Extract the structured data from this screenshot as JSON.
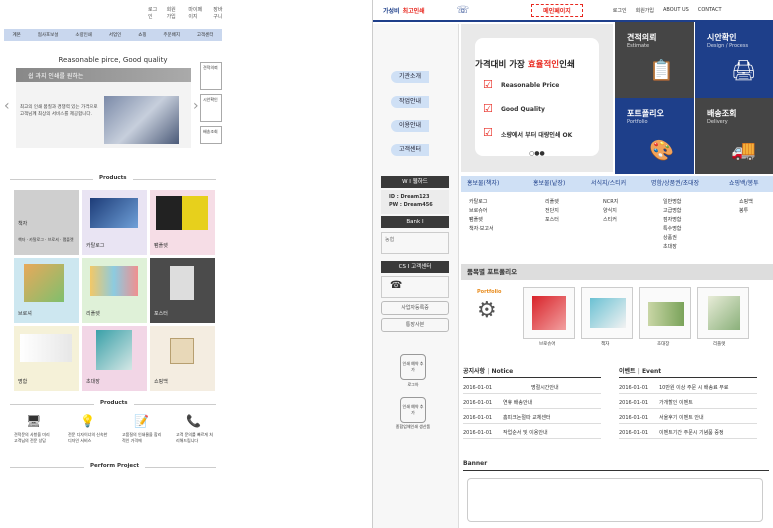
{
  "left": {
    "top_links": [
      "로그인",
      "회원가입",
      "마이페이지",
      "장바구니"
    ],
    "nav": [
      "계본",
      "협사포보설",
      "소량인쇄",
      "서업인",
      "쇼핑",
      "주문배지",
      "고객센터"
    ],
    "tagline": "Reasonable pirce, Good quality",
    "banner_head": "쉽 과지 인쇄를 원하는",
    "banner_text": "최고의 인쇄 품질과 경쟁력 있는 가격으로 고객님께 최상의 서비스를 제공합니다.",
    "side_boxes": [
      "견적의뢰",
      "시안확인",
      "배송조회"
    ],
    "products_title": "Products",
    "tiles": [
      "책자",
      "카탈로그",
      "팸플렛",
      "브로셔",
      "리플렛",
      "포스터",
      "명함",
      "초대장",
      "쇼핑백"
    ],
    "tile_overlay": "책자 · 카탈로그 · 브로셔 · 팸플렛",
    "products2_title": "Products",
    "features": [
      "견적문의 사항을 미리 고객님의 전문 상담",
      "전문 디자이너의 신속한 디자인 서비스",
      "고품질의 인쇄물을 합리적인 가격에",
      "고객 문의를 빠르게 처리해드립니다"
    ],
    "perform_title": "Perform Project"
  },
  "right": {
    "brand_prefix": "가성비",
    "brand_name": "최고인쇄",
    "main_page": "메인페이지",
    "top_links": [
      "로그인",
      "회원가입",
      "ABOUT US",
      "CONTACT"
    ],
    "side_menu": [
      "기관소개",
      "작업안내",
      "이용안내",
      "고객센터"
    ],
    "webhard_title": "W  I  웹하드",
    "webhard_id": "ID : Dream123",
    "webhard_pw": "PW : Dream456",
    "bank_title": "Bank  I",
    "bank_name": "농협",
    "cs_title": "CS  I  고객센터",
    "cs_buttons": [
      "사업자등록증",
      "통장사본"
    ],
    "small_btns": [
      "인쇄 예약 추가",
      "인쇄 예약 추가"
    ],
    "small_btn_caption": [
      "로그아",
      "종합업체인쇄 생산품"
    ],
    "hero_title_a": "가격대비 가장 ",
    "hero_title_b": "효율적인",
    "hero_title_c": "인쇄",
    "hero_points": [
      "Reasonable Price",
      "Good Quality",
      "소량에서 부터 대량인쇄 OK"
    ],
    "panels": [
      {
        "title": "견적의뢰",
        "sub": "Estimate",
        "color": "#454545"
      },
      {
        "title": "시안확인",
        "sub": "Design / Process",
        "color": "#1e3f8a"
      },
      {
        "title": "포트폴리오",
        "sub": "Portfolio",
        "color": "#1e3f8a"
      },
      {
        "title": "배송조회",
        "sub": "Delivery",
        "color": "#454545"
      }
    ],
    "tabs": [
      "홍보물(책자)",
      "홍보물(낱장)",
      "서식지/스티커",
      "명함/상품권/초대장",
      "쇼핑백/봉투"
    ],
    "cats": [
      [
        "카탈로그",
        "브로슈어",
        "팸플렛",
        "책자·보고서"
      ],
      [
        "리플렛",
        "전단지",
        "포스터"
      ],
      [
        "NCR지",
        "양식지",
        "스티커"
      ],
      [
        "일반명함",
        "고급명함",
        "점자명함",
        "특수명함",
        "상품권",
        "초대장"
      ],
      [
        "쇼핑백",
        "봉투"
      ]
    ],
    "portfolio_title": "품목별 포트폴리오",
    "portfolio_label": "Portfolio",
    "portfolio_items": [
      "브로슈어",
      "책자",
      "초대장",
      "리플렛"
    ],
    "notice_title": "공지사항",
    "notice_sub": "Notice",
    "notices": [
      {
        "date": "2016-01-01",
        "text": "명절시간안내"
      },
      {
        "date": "2016-01-01",
        "text": "연휴 배송안내"
      },
      {
        "date": "2016-01-01",
        "text": "홈피크논절따 교체센터"
      },
      {
        "date": "2016-01-01",
        "text": "작업순서 및 이용안내"
      }
    ],
    "event_title": "이벤트",
    "event_sub": "Event",
    "events": [
      {
        "date": "2016-01-01",
        "text": "10만원 이상 주문 시 배송료 무료"
      },
      {
        "date": "2016-01-01",
        "text": "가개할인 이벤트"
      },
      {
        "date": "2016-01-01",
        "text": "서울후기 이벤트 안내"
      },
      {
        "date": "2016-01-01",
        "text": "이벤트기간 주문시 기념품 증정"
      }
    ],
    "banner_title": "Banner"
  }
}
